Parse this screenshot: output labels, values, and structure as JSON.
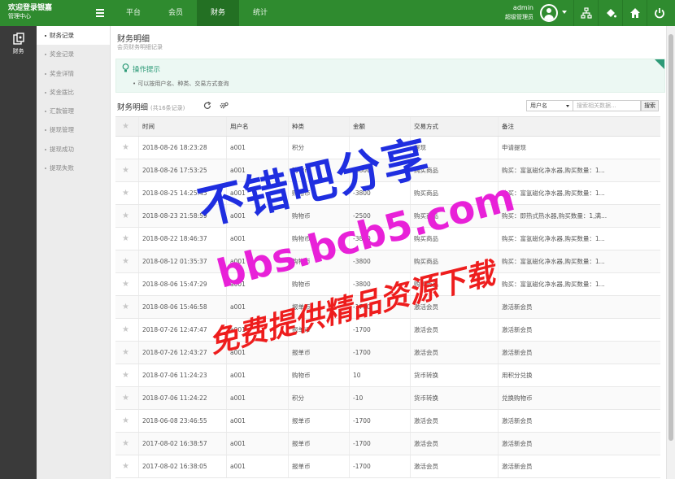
{
  "header": {
    "brand_title": "欢迎登录银嘉",
    "brand_sub": "管理中心",
    "nav": [
      {
        "label": "平台"
      },
      {
        "label": "会员"
      },
      {
        "label": "财务"
      },
      {
        "label": "统计"
      }
    ],
    "user_name": "admin",
    "user_role": "超级管理员"
  },
  "dark_sidebar": {
    "label": "财务"
  },
  "sub_sidebar": {
    "items": [
      {
        "label": "财务记录"
      },
      {
        "label": "奖金记录"
      },
      {
        "label": "奖金详情"
      },
      {
        "label": "奖金拨比"
      },
      {
        "label": "汇款管理"
      },
      {
        "label": "提现管理"
      },
      {
        "label": "提现成功"
      },
      {
        "label": "提现失败"
      }
    ]
  },
  "page": {
    "title": "财务明细",
    "subtitle": "会员财务明细记录"
  },
  "tips": {
    "title": "操作提示",
    "text": "• 可以按用户名、种类、交易方式查询"
  },
  "table": {
    "title": "财务明细",
    "count_text": "(共16条记录)",
    "search_field": "用户名",
    "search_placeholder": "搜索相关数据...",
    "search_button": "搜索",
    "columns": [
      "时间",
      "用户名",
      "种类",
      "金额",
      "交易方式",
      "备注"
    ],
    "rows": [
      {
        "time": "2018-08-26 18:23:28",
        "user": "a001",
        "type": "积分",
        "amount": "",
        "method": "提现",
        "note": "申请提现"
      },
      {
        "time": "2018-08-26 17:53:25",
        "user": "a001",
        "type": "购物币",
        "amount": "-3800",
        "method": "购买商品",
        "note": "购买：富氢磁化净水器,购买数量：1..."
      },
      {
        "time": "2018-08-25 14:25:45",
        "user": "a001",
        "type": "购物币",
        "amount": "-3800",
        "method": "购买商品",
        "note": "购买：富氢磁化净水器,购买数量：1..."
      },
      {
        "time": "2018-08-23 21:58:59",
        "user": "a001",
        "type": "购物币",
        "amount": "-2500",
        "method": "购买商品",
        "note": "购买：即热式热水器,购买数量：1,满..."
      },
      {
        "time": "2018-08-22 18:46:37",
        "user": "a001",
        "type": "购物币",
        "amount": "-3800",
        "method": "购买商品",
        "note": "购买：富氢磁化净水器,购买数量：1..."
      },
      {
        "time": "2018-08-12 01:35:37",
        "user": "a001",
        "type": "购物币",
        "amount": "-3800",
        "method": "购买商品",
        "note": "购买：富氢磁化净水器,购买数量：1..."
      },
      {
        "time": "2018-08-06 15:47:29",
        "user": "a001",
        "type": "购物币",
        "amount": "-3800",
        "method": "购买商品",
        "note": "购买：富氢磁化净水器,购买数量：1..."
      },
      {
        "time": "2018-08-06 15:46:58",
        "user": "a001",
        "type": "报单币",
        "amount": "-1700",
        "method": "激活会员",
        "note": "激活新会员"
      },
      {
        "time": "2018-07-26 12:47:47",
        "user": "a001",
        "type": "报单币",
        "amount": "-1700",
        "method": "激活会员",
        "note": "激活新会员"
      },
      {
        "time": "2018-07-26 12:43:27",
        "user": "a001",
        "type": "报单币",
        "amount": "-1700",
        "method": "激活会员",
        "note": "激活新会员"
      },
      {
        "time": "2018-07-06 11:24:23",
        "user": "a001",
        "type": "购物币",
        "amount": "10",
        "method": "货币转换",
        "note": "用积分兑换"
      },
      {
        "time": "2018-07-06 11:24:22",
        "user": "a001",
        "type": "积分",
        "amount": "-10",
        "method": "货币转换",
        "note": "兑换购物币"
      },
      {
        "time": "2018-06-08 23:46:55",
        "user": "a001",
        "type": "报单币",
        "amount": "-1700",
        "method": "激活会员",
        "note": "激活新会员"
      },
      {
        "time": "2017-08-02 16:38:57",
        "user": "a001",
        "type": "报单币",
        "amount": "-1700",
        "method": "激活会员",
        "note": "激活新会员"
      },
      {
        "time": "2017-08-02 16:38:05",
        "user": "a001",
        "type": "报单币",
        "amount": "-1700",
        "method": "激活会员",
        "note": "激活新会员"
      }
    ]
  },
  "watermark": {
    "line1": "不错吧分享",
    "line2": "bbs.bcb5.com",
    "line3": "免费提供精品资源下载"
  },
  "colors": {
    "header_green": "#2f8b2f",
    "active_nav": "#237023",
    "tips_green": "#2d9a77",
    "dark_sidebar": "#3a3a3a"
  }
}
